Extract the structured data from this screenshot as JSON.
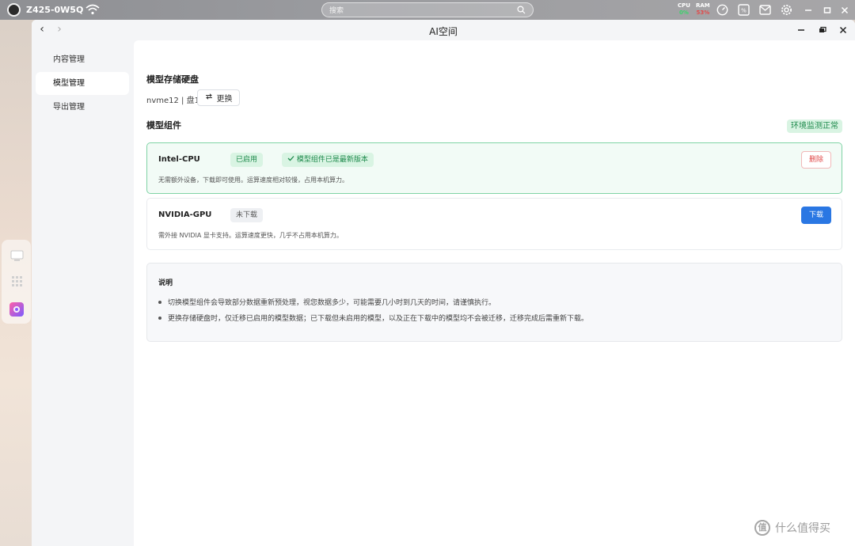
{
  "system_bar": {
    "device_name": "Z425-0W5Q",
    "search_placeholder": "搜索",
    "cpu": {
      "label": "CPU",
      "value": "0%",
      "color": "#3bd46b"
    },
    "ram": {
      "label": "RAM",
      "value": "53%",
      "color": "#e24b4b"
    },
    "icons": [
      "dashboard-gauge-icon",
      "percent-app-icon",
      "mail-icon",
      "gear-icon",
      "minimize-icon",
      "maximize-icon",
      "close-icon"
    ]
  },
  "dock": {
    "items": [
      "desktop-icon",
      "apps-grid-icon",
      "ai-space-app-icon"
    ]
  },
  "window": {
    "title": "AI空间",
    "back_label": "‹",
    "forward_label": "›"
  },
  "sidebar": {
    "items": [
      {
        "label": "内容管理",
        "active": false
      },
      {
        "label": "模型管理",
        "active": true
      },
      {
        "label": "导出管理",
        "active": false
      }
    ]
  },
  "main": {
    "storage": {
      "title": "模型存储硬盘",
      "disk_info": "nvme12 | 盘1",
      "change_label": "更换"
    },
    "components": {
      "title": "模型组件",
      "env_status": "环境监测正常",
      "cards": [
        {
          "name": "Intel-CPU",
          "status_tag": "已启用",
          "version_tag": "模型组件已是最新版本",
          "description": "无需额外设备，下载即可使用。运算速度相对较慢，占用本机算力。",
          "action": "删除"
        },
        {
          "name": "NVIDIA-GPU",
          "status_tag": "未下载",
          "description": "需外接 NVIDIA 显卡支持。运算速度更快，几乎不占用本机算力。",
          "action": "下载"
        }
      ]
    },
    "notes": {
      "title": "说明",
      "items": [
        "切换模型组件会导致部分数据重新预处理，视您数据多少，可能需要几小时到几天的时间，请谨慎执行。",
        "更换存储硬盘时，仅迁移已启用的模型数据；已下载但未启用的模型，以及正在下载中的模型均不会被迁移，迁移完成后需重新下载。"
      ]
    }
  },
  "watermark": {
    "logo_text": "值",
    "text": "什么值得买"
  }
}
